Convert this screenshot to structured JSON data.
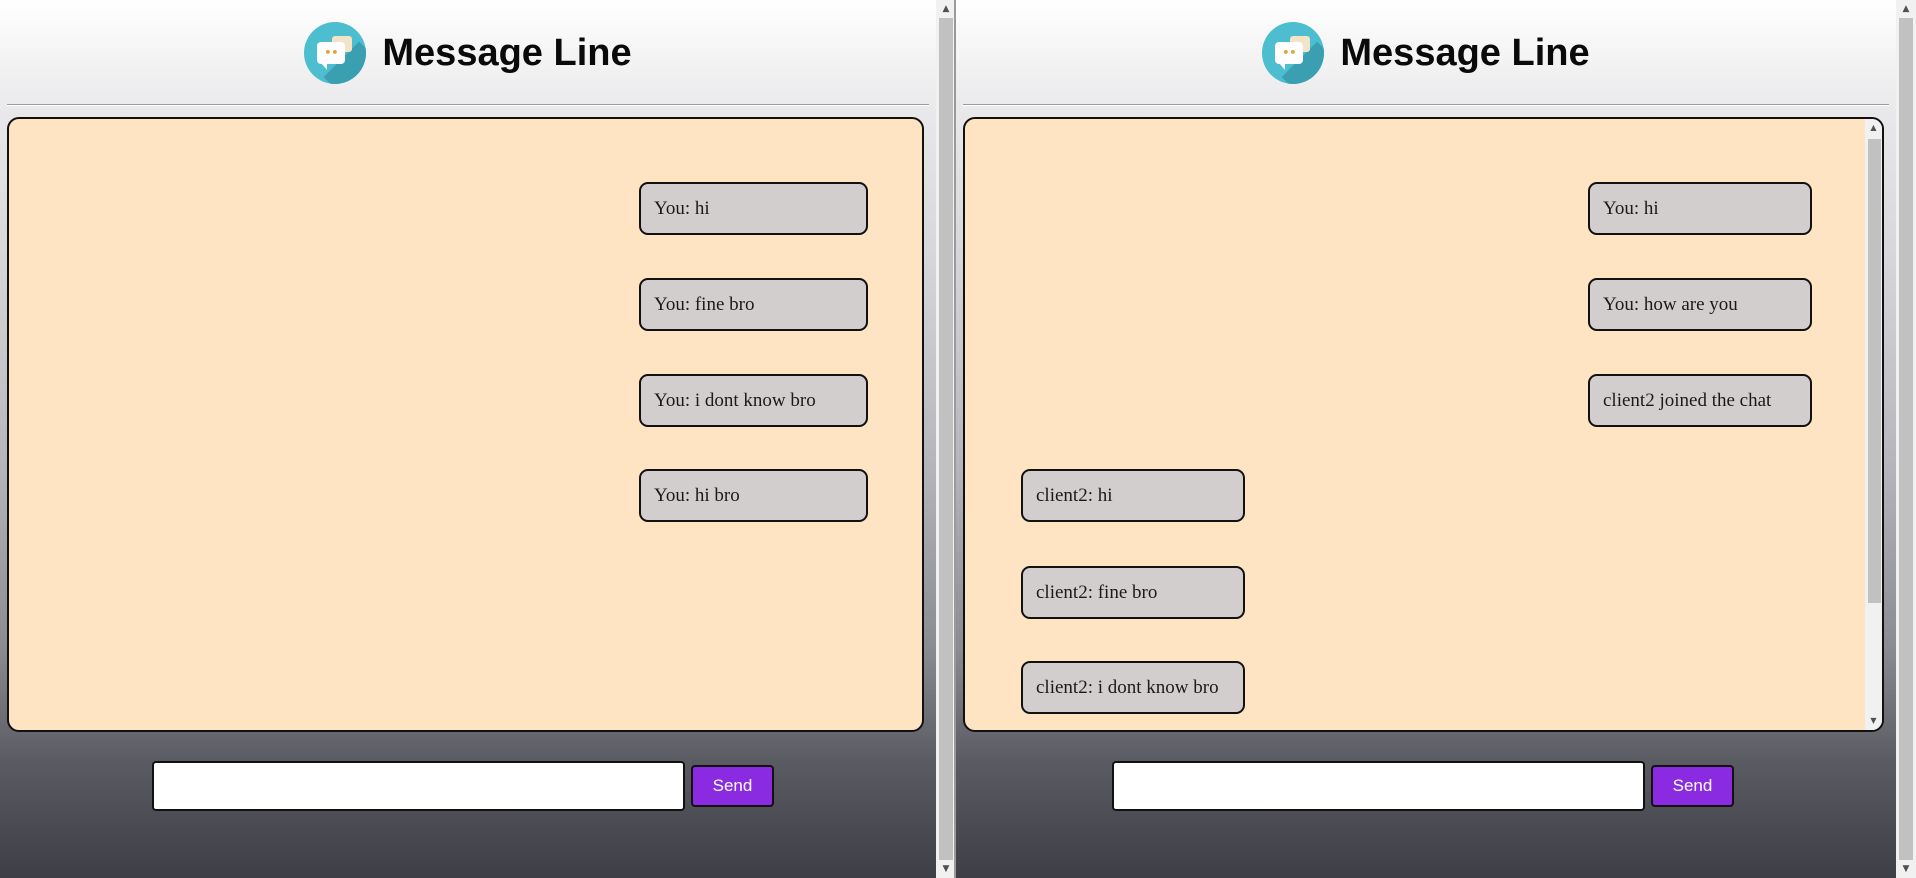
{
  "app": {
    "title": "Message Line",
    "logo_icon": "chat-bubble-logo-icon",
    "accent_color": "#8a2be2",
    "chat_bg_color": "#ffe4c4",
    "bubble_color": "#d3cece"
  },
  "left_client": {
    "messages": [
      {
        "text": "You: hi",
        "side": "right"
      },
      {
        "text": "You: fine bro",
        "side": "right"
      },
      {
        "text": "You: i dont know bro",
        "side": "right"
      },
      {
        "text": "You: hi bro",
        "side": "right"
      }
    ],
    "input": {
      "value": "",
      "placeholder": ""
    },
    "send_label": "Send"
  },
  "right_client": {
    "messages": [
      {
        "text": "You: hi",
        "side": "right"
      },
      {
        "text": "You: how are you",
        "side": "right"
      },
      {
        "text": "client2 joined the chat",
        "side": "right"
      },
      {
        "text": "client2: hi",
        "side": "left"
      },
      {
        "text": "client2: fine bro",
        "side": "left"
      },
      {
        "text": "client2: i dont know bro",
        "side": "left"
      }
    ],
    "input": {
      "value": "",
      "placeholder": ""
    },
    "send_label": "Send"
  }
}
